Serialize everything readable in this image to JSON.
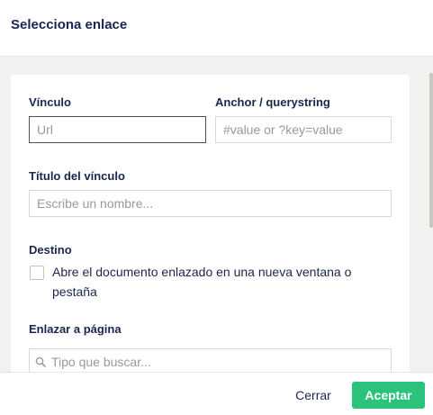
{
  "dialog": {
    "title": "Selecciona enlace"
  },
  "form": {
    "link": {
      "label": "Vínculo",
      "placeholder": "Url",
      "value": ""
    },
    "anchor": {
      "label": "Anchor / querystring",
      "placeholder": "#value or ?key=value",
      "value": ""
    },
    "link_title": {
      "label": "Título del vínculo",
      "placeholder": "Escribe un nombre...",
      "value": ""
    },
    "target": {
      "label": "Destino",
      "checkbox_label": "Abre el documento enlazado en una nueva ventana o pestaña",
      "checked": false
    },
    "link_to_page": {
      "label": "Enlazar a página",
      "search_placeholder": "Tipo que buscar...",
      "search_icon": "search-icon"
    }
  },
  "footer": {
    "cancel_label": "Cerrar",
    "accept_label": "Aceptar"
  },
  "colors": {
    "accent": "#2bc37c",
    "text": "#1b264f",
    "background": "#f3f1ef"
  }
}
